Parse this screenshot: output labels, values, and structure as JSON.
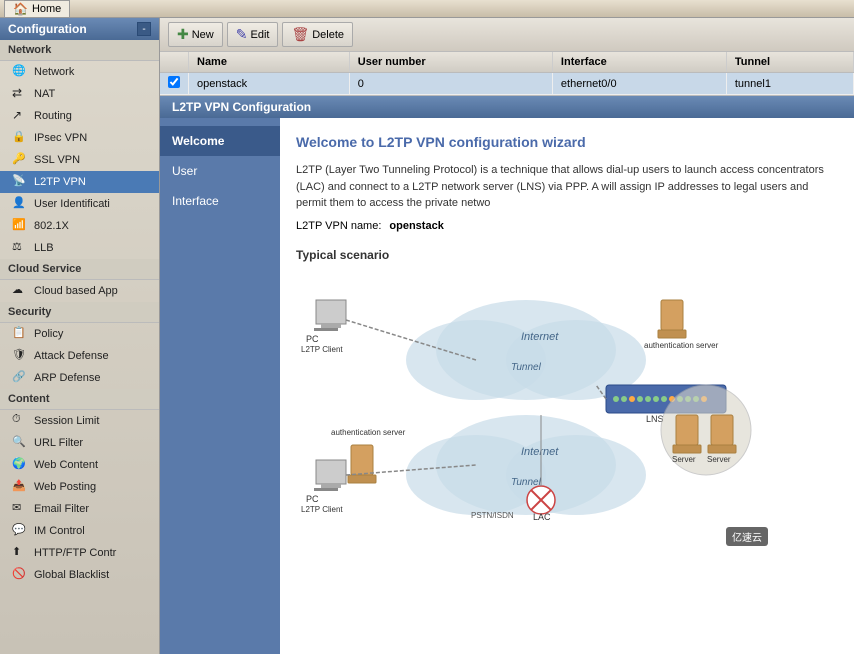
{
  "topbar": {
    "home_label": "Home"
  },
  "sidebar": {
    "config_label": "Configuration",
    "network_group": "Network",
    "items_network": [
      {
        "id": "network",
        "label": "Network",
        "icon": "network"
      },
      {
        "id": "nat",
        "label": "NAT",
        "icon": "nat"
      },
      {
        "id": "routing",
        "label": "Routing",
        "icon": "routing"
      },
      {
        "id": "ipsec",
        "label": "IPsec VPN",
        "icon": "ipsec"
      },
      {
        "id": "ssl",
        "label": "SSL VPN",
        "icon": "ssl"
      },
      {
        "id": "l2tp",
        "label": "L2TP VPN",
        "icon": "l2tp",
        "active": true
      },
      {
        "id": "user",
        "label": "User Identificati",
        "icon": "user"
      },
      {
        "id": "802",
        "label": "802.1X",
        "icon": "802"
      },
      {
        "id": "llb",
        "label": "LLB",
        "icon": "llb"
      }
    ],
    "cloud_group": "Cloud Service",
    "items_cloud": [
      {
        "id": "cloud",
        "label": "Cloud based App",
        "icon": "cloud"
      }
    ],
    "security_group": "Security",
    "items_security": [
      {
        "id": "policy",
        "label": "Policy",
        "icon": "policy"
      },
      {
        "id": "attack",
        "label": "Attack Defense",
        "icon": "attack"
      },
      {
        "id": "arp",
        "label": "ARP Defense",
        "icon": "arp"
      }
    ],
    "content_group": "Content",
    "items_content": [
      {
        "id": "session",
        "label": "Session Limit",
        "icon": "session"
      },
      {
        "id": "url",
        "label": "URL Filter",
        "icon": "url"
      },
      {
        "id": "webcontent",
        "label": "Web Content",
        "icon": "web"
      },
      {
        "id": "webpost",
        "label": "Web Posting",
        "icon": "webpost"
      },
      {
        "id": "email",
        "label": "Email Filter",
        "icon": "email"
      },
      {
        "id": "im",
        "label": "IM Control",
        "icon": "im"
      },
      {
        "id": "http",
        "label": "HTTP/FTP Contr",
        "icon": "http"
      },
      {
        "id": "global",
        "label": "Global Blacklist",
        "icon": "global"
      }
    ]
  },
  "toolbar": {
    "new_label": "New",
    "edit_label": "Edit",
    "delete_label": "Delete"
  },
  "table": {
    "columns": [
      "Name",
      "User number",
      "Interface",
      "Tunnel"
    ],
    "rows": [
      {
        "name": "openstack",
        "user_number": "0",
        "interface": "ethernet0/0",
        "tunnel": "tunnel1",
        "selected": true
      }
    ]
  },
  "config": {
    "panel_title": "L2TP VPN Configuration",
    "wizard_items": [
      "Welcome",
      "User",
      "Interface"
    ],
    "active_wizard": "Welcome",
    "welcome_title": "Welcome to L2TP VPN configuration wizard",
    "welcome_text1": "L2TP (Layer Two Tunneling Protocol) is a technique that allows dial-up users to lau access concentrators (LAC) and connect to a L2TP network server (LNS) via PPP. A will assign IP addresses to legal users and permit them to access the private netwo",
    "vpn_name_label": "L2TP VPN name:",
    "vpn_name_value": "openstack",
    "scenario_label": "Typical scenario"
  },
  "diagram": {
    "pc_left_label": "PC",
    "l2tp_client_left": "L2TP Client",
    "internet_top": "Internet",
    "tunnel_top": "Tunnel",
    "auth_server_top": "authentication server",
    "lns_label": "LNS",
    "server1": "Server",
    "server2": "Server",
    "auth_server_bottom": "authentication server",
    "pstn_label": "PSTN/ISDN",
    "internet_bottom": "Internet",
    "tunnel_bottom": "Tunnel",
    "lac_label": "LAC",
    "pc_bottom_label": "PC",
    "l2tp_client_bottom": "L2TP Client"
  },
  "watermark": "亿速云"
}
